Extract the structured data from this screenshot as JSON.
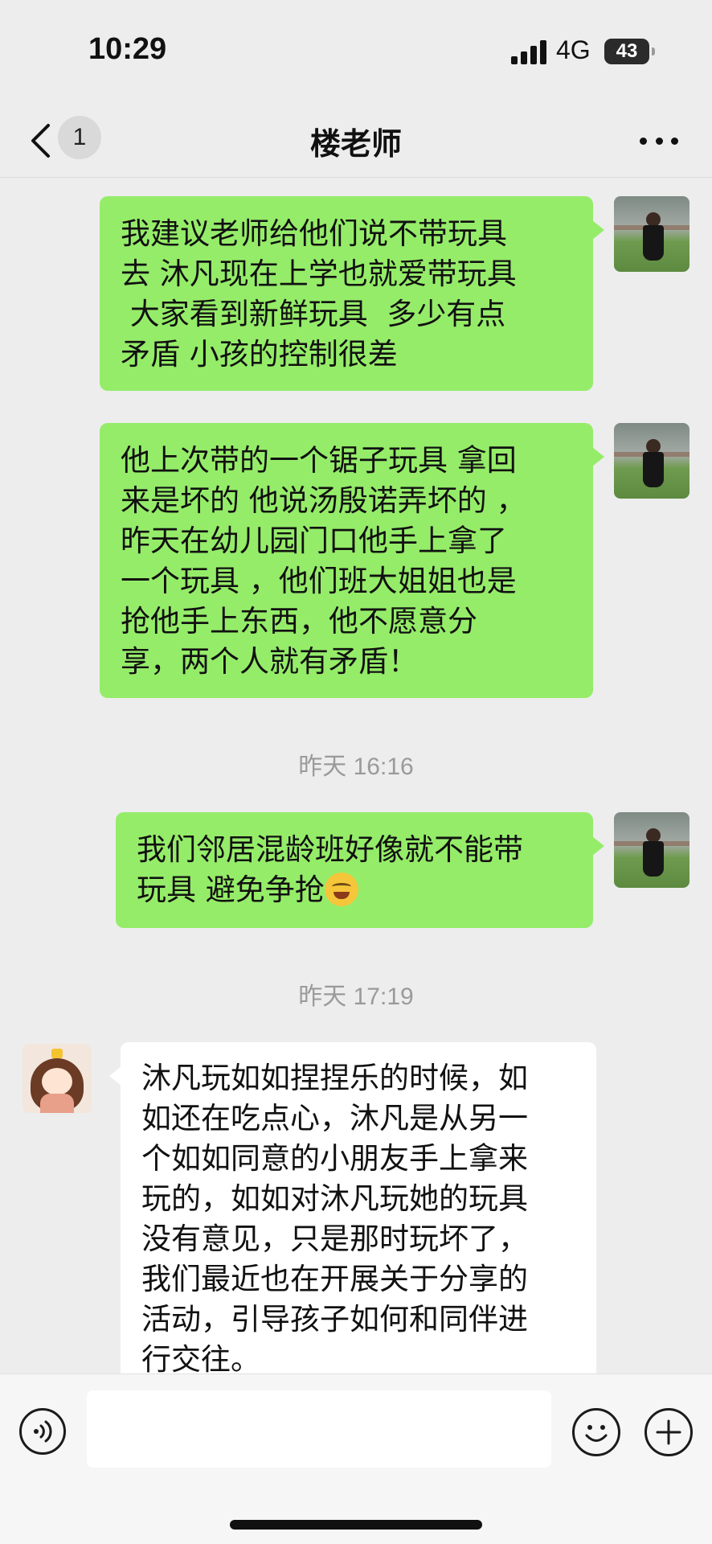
{
  "status_bar": {
    "time": "10:29",
    "network": "4G",
    "battery": "43"
  },
  "nav": {
    "unread_count": "1",
    "title": "楼老师"
  },
  "messages": [
    {
      "sender": "me",
      "text": "我建议老师给他们说不带玩具\n去 沐凡现在上学也就爱带玩具\n 大家看到新鲜玩具  多少有点\n矛盾 小孩的控制很差"
    },
    {
      "sender": "me",
      "text": "他上次带的一个锯子玩具 拿回\n来是坏的 他说汤殷诺弄坏的 ，\n昨天在幼儿园门口他手上拿了\n一个玩具 ，他们班大姐姐也是\n抢他手上东西，他不愿意分\n享，两个人就有矛盾！"
    },
    {
      "sender": "timestamp",
      "text": "昨天 16:16"
    },
    {
      "sender": "me",
      "text_line1": "我们邻居混龄班好像就不能带",
      "text_line2": "玩具 避免争抢",
      "emoji": "crying-laughing-face"
    },
    {
      "sender": "timestamp",
      "text": "昨天 17:19"
    },
    {
      "sender": "teacher",
      "text": "沐凡玩如如捏捏乐的时候，如\n如还在吃点心，沐凡是从另一\n个如如同意的小朋友手上拿来\n玩的，如如对沐凡玩她的玩具\n没有意见，只是那时玩坏了，\n我们最近也在开展关于分享的\n活动，引导孩子如何和同伴进\n行交往。"
    }
  ],
  "input_bar": {
    "placeholder": "",
    "icons": [
      "voice-icon",
      "emoji-icon",
      "plus-icon"
    ]
  },
  "colors": {
    "outgoing_bubble": "#95ec69",
    "incoming_bubble": "#ffffff",
    "background": "#ededed"
  }
}
